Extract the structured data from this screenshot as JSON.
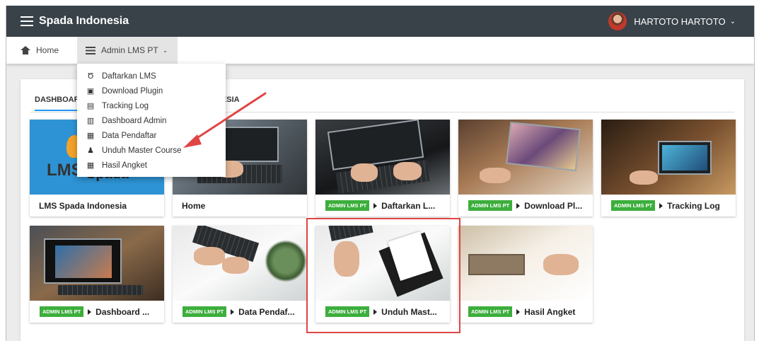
{
  "header": {
    "brand": "Spada Indonesia",
    "user_name": "HARTOTO HARTOTO",
    "user_caret": "⌄"
  },
  "nav": {
    "home_label": "Home",
    "admin_label": "Admin LMS PT",
    "admin_caret": "⌄"
  },
  "dropdown": {
    "items": [
      {
        "label": "Daftarkan LMS",
        "icon": "medal-icon",
        "glyph": "Ծ"
      },
      {
        "label": "Download Plugin",
        "icon": "plugin-icon",
        "glyph": "▣"
      },
      {
        "label": "Tracking Log",
        "icon": "log-icon",
        "glyph": "▤"
      },
      {
        "label": "Dashboard Admin",
        "icon": "dashboard-icon",
        "glyph": "▥"
      },
      {
        "label": "Data Pendaftar",
        "icon": "table-icon",
        "glyph": "▦"
      },
      {
        "label": "Unduh Master Course",
        "icon": "user-download-icon",
        "glyph": "♟"
      },
      {
        "label": "Hasil Angket",
        "icon": "table-icon",
        "glyph": "▦"
      }
    ]
  },
  "tabs": {
    "active": "DASHBOARD",
    "second": "NESIA"
  },
  "badge_text": "ADMIN LMS PT",
  "cards": [
    {
      "title": "LMS Spada Indonesia",
      "badge": false,
      "thumb_text": "LMS",
      "thumb_sub": "Spada"
    },
    {
      "title": "Home",
      "badge": false
    },
    {
      "title": "Daftarkan L...",
      "badge": true
    },
    {
      "title": "Download Pl...",
      "badge": true
    },
    {
      "title": "Tracking Log",
      "badge": true
    },
    {
      "title": "Dashboard ...",
      "badge": true
    },
    {
      "title": "Data Pendaf...",
      "badge": true
    },
    {
      "title": "Unduh Mast...",
      "badge": true
    },
    {
      "title": "Hasil Angket",
      "badge": true
    }
  ],
  "colors": {
    "topbar": "#394149",
    "badge": "#3cae3c",
    "highlight": "#e04545",
    "tab_underline": "#2196f3"
  }
}
